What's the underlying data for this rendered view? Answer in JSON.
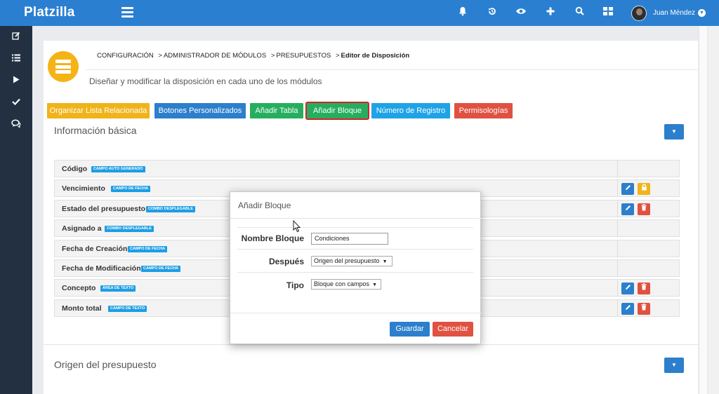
{
  "app": {
    "brand": "Platzilla"
  },
  "topbar": {
    "icons": [
      "bell-icon",
      "history-icon",
      "eye-icon",
      "plus-icon",
      "search-icon",
      "grid-icon"
    ],
    "user_name": "Juan Méndez"
  },
  "sidebar": {
    "icons": [
      "edit-icon",
      "list-icon",
      "play-icon",
      "check-icon",
      "chat-icon"
    ]
  },
  "breadcrumb": {
    "items": [
      "CONFIGURACIÓN",
      "ADMINISTRADOR DE MÓDULOS",
      "PRESUPUESTOS"
    ],
    "current": "Editor de Disposición",
    "separator": ">"
  },
  "page": {
    "subtitle": "Diseñar y modificar la disposición en cada uno de los módulos"
  },
  "toolbar": {
    "buttons": [
      {
        "label": "Organizar Lista Relacionada",
        "color": "#f0b41a"
      },
      {
        "label": "Botones Personalizados",
        "color": "#2c7fcc"
      },
      {
        "label": "Añadir Tabla",
        "color": "#26ae5f"
      },
      {
        "label": "Añadir Bloque",
        "color": "#26ae5f",
        "highlighted": true
      },
      {
        "label": "Número de Registro",
        "color": "#1fa3e6"
      },
      {
        "label": "Permisologías",
        "color": "#e05141"
      }
    ]
  },
  "sections": [
    {
      "title": "Información básica",
      "fields": [
        {
          "name": "Código",
          "tag": "CAMPO AUTO GENERADO",
          "actions": []
        },
        {
          "name": "Vencimiento",
          "tag": "CAMPO DE FECHA",
          "actions": [
            "edit",
            "lock"
          ]
        },
        {
          "name": "Estado del presupuesto",
          "tag": "COMBO DESPLEGABLE",
          "actions": [
            "edit",
            "delete"
          ]
        },
        {
          "name": "Asignado a",
          "tag": "COMBO DESPLEGABLE",
          "actions": []
        },
        {
          "name": "Fecha de Creación",
          "tag": "CAMPO DE FECHA",
          "actions": []
        },
        {
          "name": "Fecha de Modificación",
          "tag": "CAMPO DE FECHA",
          "actions": []
        },
        {
          "name": "Concepto",
          "tag": "ÁREA DE TEXTO",
          "actions": [
            "edit",
            "delete"
          ]
        },
        {
          "name": "Monto total",
          "tag": "CAMPO DE TEXTO",
          "actions": [
            "edit",
            "delete"
          ]
        }
      ]
    },
    {
      "title": "Origen del presupuesto",
      "fields": []
    }
  ],
  "modal": {
    "title": "Añadir Bloque",
    "fields": [
      {
        "label": "Nombre Bloque",
        "type": "text",
        "value": "Condiciones"
      },
      {
        "label": "Después",
        "type": "select",
        "value": "Origen del presupuesto"
      },
      {
        "label": "Tipo",
        "type": "select",
        "value": "Bloque con campos"
      }
    ],
    "save_label": "Guardar",
    "cancel_label": "Cancelar",
    "colors": {
      "save": "#2c7fcc",
      "cancel": "#e05141"
    }
  }
}
